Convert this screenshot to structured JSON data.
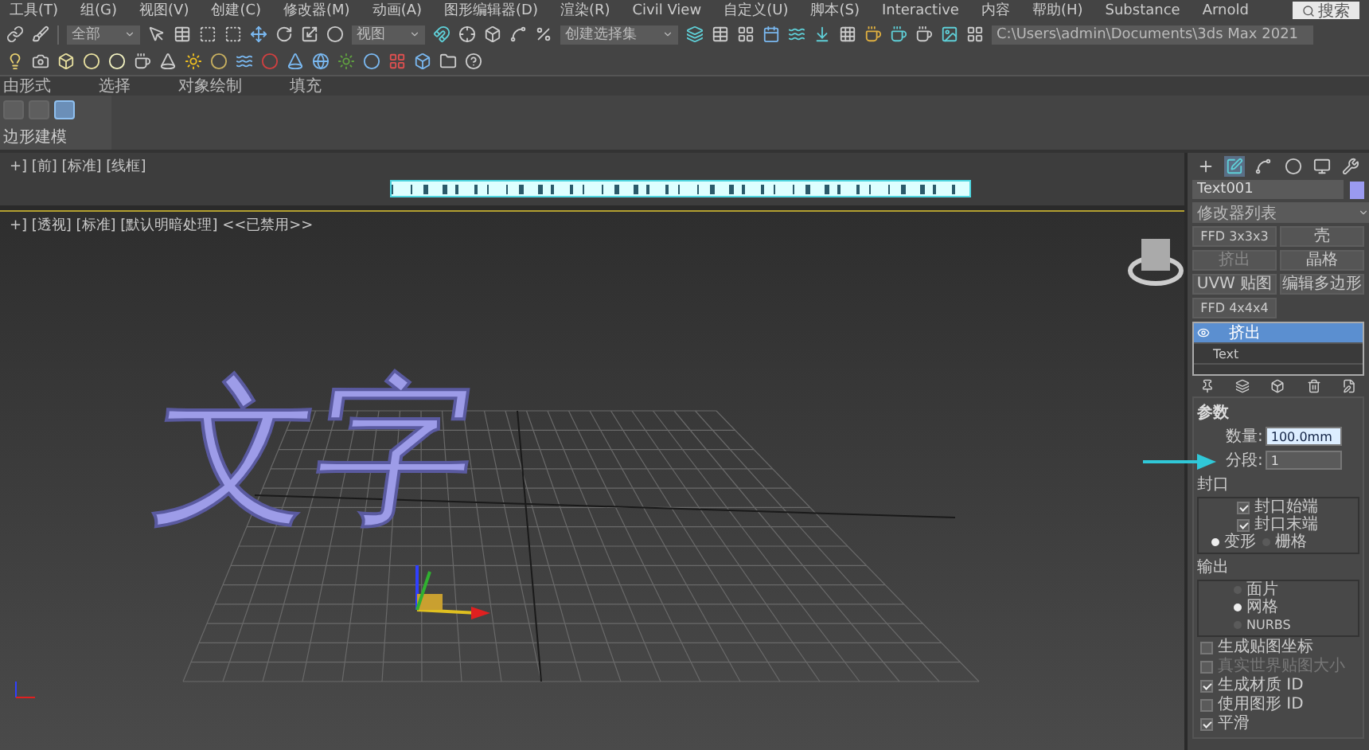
{
  "menu": [
    "工具(T)",
    "组(G)",
    "视图(V)",
    "创建(C)",
    "修改器(M)",
    "动画(A)",
    "图形编辑器(D)",
    "渲染(R)",
    "Civil View",
    "自定义(U)",
    "脚本(S)",
    "Interactive",
    "内容",
    "帮助(H)",
    "Substance",
    "Arnold"
  ],
  "search": {
    "placeholder": "搜索"
  },
  "toolbar": {
    "selection_filter": "全部",
    "view_dropdown": "视图",
    "selection_set": {
      "placeholder": "创建选择集"
    },
    "project_path": "C:\\Users\\admin\\Documents\\3ds Max 2021"
  },
  "ribbon": {
    "tabs": [
      "由形式",
      "选择",
      "对象绘制",
      "填充"
    ],
    "panel_label": "边形建模"
  },
  "top_viewport": {
    "label": "+] [前] [标准] [线框]"
  },
  "viewport": {
    "label": "+] [透视] [标准] [默认明暗处理] <<已禁用>>",
    "scene_text": "文字"
  },
  "command_panel": {
    "tabs": [
      {
        "selected": false
      },
      {
        "selected": true
      },
      {
        "selected": false
      },
      {
        "selected": false
      },
      {
        "selected": false
      },
      {
        "selected": false
      }
    ],
    "object_name": "Text001",
    "modifier_list": "修改器列表",
    "modifier_buttons": [
      {
        "label": "FFD 3x3x3",
        "disabled": false
      },
      {
        "label": "壳",
        "disabled": false
      },
      {
        "label": "挤出",
        "disabled": true
      },
      {
        "label": "晶格",
        "disabled": false
      },
      {
        "label": "UVW 贴图",
        "disabled": false
      },
      {
        "label": "编辑多边形",
        "disabled": false
      },
      {
        "label": "FFD 4x4x4",
        "disabled": false
      }
    ],
    "stack": [
      {
        "label": "挤出",
        "selected": true,
        "eye": true
      },
      {
        "label": "Text",
        "selected": false,
        "eye": false
      }
    ],
    "rollout": {
      "title": "参数",
      "amount_label": "数量:",
      "amount": "100.0mm",
      "segments_label": "分段:",
      "segments": "1",
      "cap_group": "封口",
      "caps": [
        {
          "label": "封口始端",
          "checked": true
        },
        {
          "label": "封口末端",
          "checked": true
        }
      ],
      "cap_types": [
        {
          "label": "变形",
          "selected": true
        },
        {
          "label": "栅格",
          "selected": false
        }
      ],
      "output_group": "输出",
      "outputs": [
        {
          "label": "面片",
          "selected": false
        },
        {
          "label": "网格",
          "selected": true
        },
        {
          "label": "NURBS",
          "selected": false
        }
      ],
      "options": [
        {
          "label": "生成贴图坐标",
          "checked": false,
          "disabled": false
        },
        {
          "label": "真实世界贴图大小",
          "checked": false,
          "disabled": true
        },
        {
          "label": "生成材质 ID",
          "checked": true,
          "disabled": false
        },
        {
          "label": "使用图形 ID",
          "checked": false,
          "disabled": false
        },
        {
          "label": "平滑",
          "checked": true,
          "disabled": false
        }
      ]
    }
  }
}
